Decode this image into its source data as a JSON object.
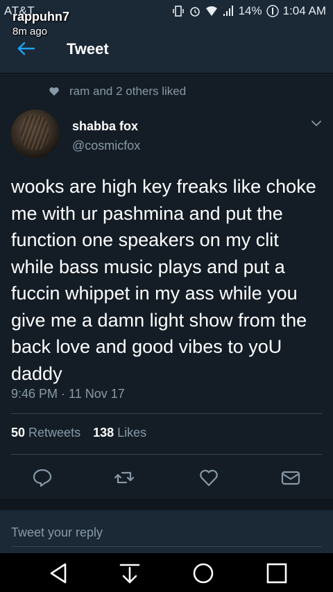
{
  "status_bar": {
    "carrier": "AT&T",
    "battery": "14%",
    "time": "1:04 AM"
  },
  "snap": {
    "username": "rappuhn7",
    "time_ago": "8m ago"
  },
  "header": {
    "title": "Tweet"
  },
  "social_context": {
    "text": "ram and 2 others liked"
  },
  "author": {
    "name": "shabba fox",
    "handle": "@cosmicfox"
  },
  "tweet": {
    "text": "wooks are high key freaks like choke me with ur pashmina and put the function one speakers on my clit while bass music plays and put a fuccin whippet in my ass while you give me a damn light show from the back love and good vibes to yoU daddy",
    "timestamp": "9:46 PM · 11 Nov 17"
  },
  "stats": {
    "retweets_count": "50",
    "retweets_label": "Retweets",
    "likes_count": "138",
    "likes_label": "Likes"
  },
  "reply": {
    "placeholder": "Tweet your reply"
  },
  "colors": {
    "background": "#141d26",
    "header": "#1b2836",
    "secondary_text": "#8899a6",
    "divider": "#38444d"
  },
  "icons": [
    "back-arrow-icon",
    "heart-icon",
    "chevron-down-icon",
    "reply-icon",
    "retweet-icon",
    "like-icon",
    "message-icon",
    "nav-back-icon",
    "nav-down-icon",
    "nav-home-icon",
    "nav-recents-icon"
  ]
}
